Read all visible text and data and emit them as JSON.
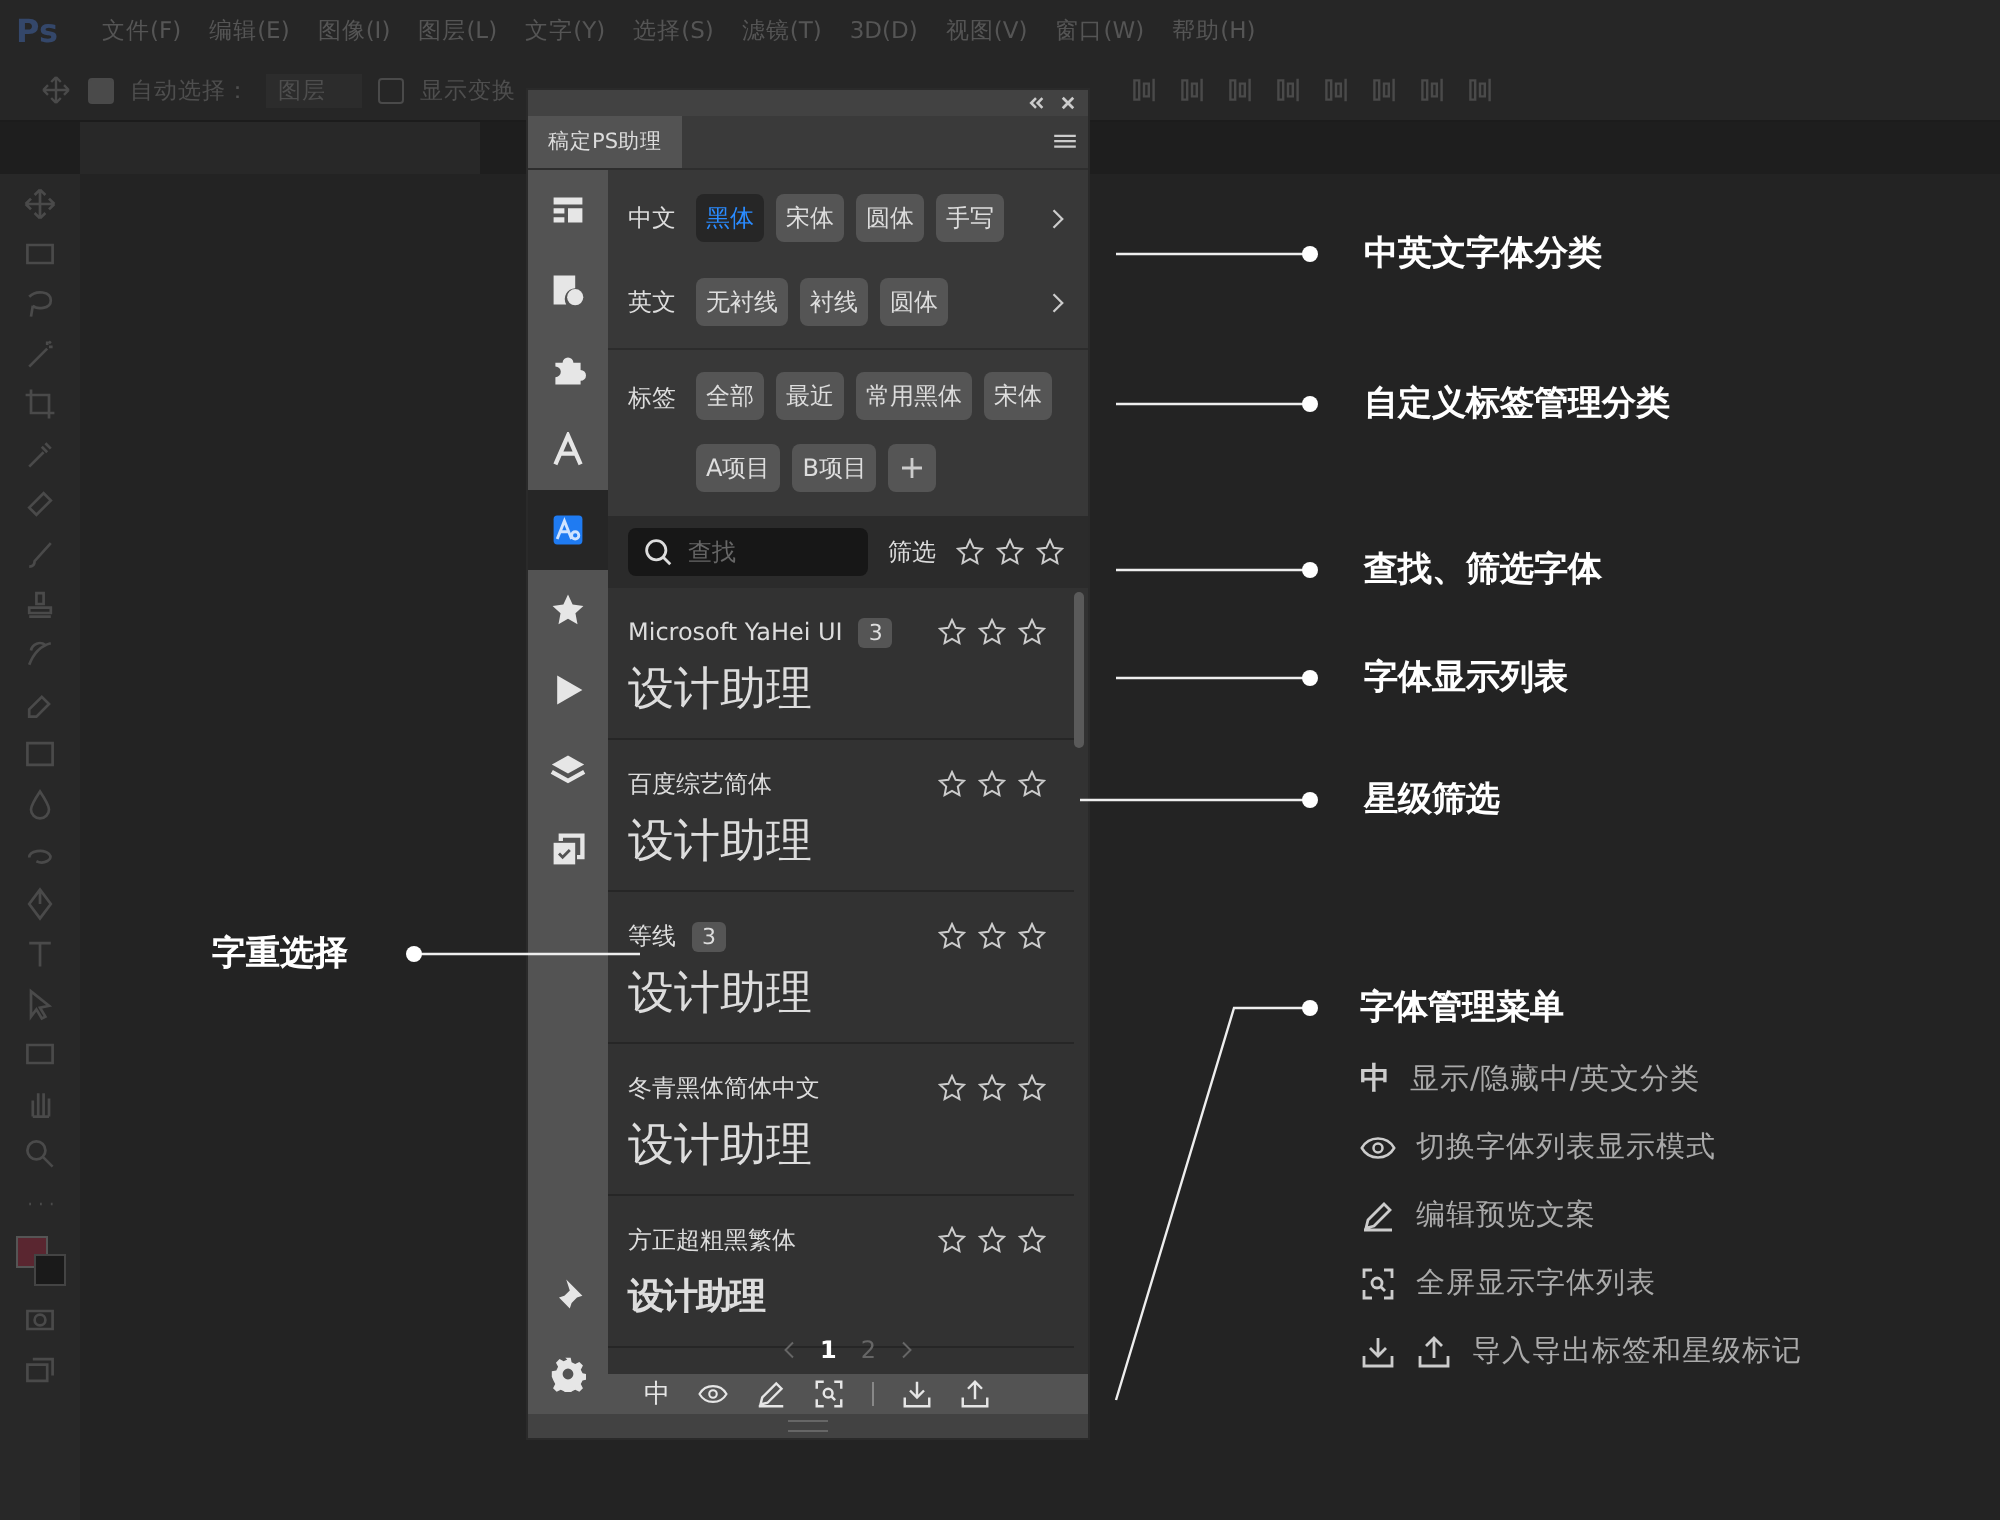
{
  "menu_bar": {
    "logo": "Ps",
    "items": [
      "文件(F)",
      "编辑(E)",
      "图像(I)",
      "图层(L)",
      "文字(Y)",
      "选择(S)",
      "滤镜(T)",
      "3D(D)",
      "视图(V)",
      "窗口(W)",
      "帮助(H)"
    ]
  },
  "options_bar": {
    "auto_select": {
      "label": "自动选择：",
      "checked": true
    },
    "target": "图层",
    "show_transform": {
      "label": "显示变换",
      "checked": false
    }
  },
  "panel": {
    "title": "稿定PS助理",
    "nav": [
      {
        "kind": "layout",
        "selected": false
      },
      {
        "kind": "shapes",
        "selected": false
      },
      {
        "kind": "puzzle",
        "selected": false
      },
      {
        "kind": "text",
        "selected": false
      },
      {
        "kind": "font-search",
        "selected": true
      },
      {
        "kind": "star",
        "selected": false
      },
      {
        "kind": "play",
        "selected": false
      },
      {
        "kind": "layers",
        "selected": false
      },
      {
        "kind": "checklist",
        "selected": false
      }
    ],
    "chinese": {
      "label": "中文",
      "chips": [
        {
          "label": "黑体",
          "selected": true
        },
        {
          "label": "宋体",
          "selected": false
        },
        {
          "label": "圆体",
          "selected": false
        },
        {
          "label": "手写",
          "selected": false
        }
      ]
    },
    "english": {
      "label": "英文",
      "chips": [
        {
          "label": "无衬线",
          "selected": false
        },
        {
          "label": "衬线",
          "selected": false
        },
        {
          "label": "圆体",
          "selected": false
        }
      ]
    },
    "tags": {
      "label": "标签",
      "chips": [
        {
          "label": "全部",
          "selected": false
        },
        {
          "label": "最近",
          "selected": false
        },
        {
          "label": "常用黑体",
          "selected": false
        },
        {
          "label": "宋体",
          "selected": false
        },
        {
          "label": "A项目",
          "selected": false
        },
        {
          "label": "B项目",
          "selected": false
        }
      ]
    },
    "search": {
      "placeholder": "查找"
    },
    "filter": {
      "label": "筛选",
      "stars": 0
    },
    "fonts": [
      {
        "name": "Microsoft YaHei UI",
        "count": "3",
        "preview": "设计助理",
        "kind": "normal",
        "stars": 0
      },
      {
        "name": "百度综艺简体",
        "preview": "设计助理",
        "kind": "normal",
        "stars": 0
      },
      {
        "name": "等线",
        "count": "3",
        "preview": "设计助理",
        "kind": "normal",
        "stars": 0
      },
      {
        "name": "冬青黑体简体中文",
        "preview": "设计助理",
        "kind": "normal",
        "stars": 0
      },
      {
        "name": "方正超粗黑繁体",
        "preview": "设计助理",
        "kind": "heavy",
        "stars": 0
      }
    ],
    "pages": [
      {
        "label": "1",
        "selected": true
      },
      {
        "label": "2",
        "selected": false
      }
    ],
    "toolbar": {
      "lang_toggle": "中"
    }
  },
  "annotations": [
    {
      "title": "中英文字体分类"
    },
    {
      "title": "自定义标签管理分类"
    },
    {
      "title": "查找、筛选字体"
    },
    {
      "title": "字体显示列表"
    },
    {
      "title": "星级筛选"
    }
  ],
  "weight_note": {
    "title": "字重选择"
  },
  "menu_note": {
    "title": "字体管理菜单",
    "items": [
      {
        "kind": "lang",
        "icon_text": "中",
        "text": "显示/隐藏中/英文分类"
      },
      {
        "kind": "eye",
        "text": "切换字体列表显示模式"
      },
      {
        "kind": "edit",
        "text": "编辑预览文案"
      },
      {
        "kind": "scan",
        "text": "全屏显示字体列表"
      },
      {
        "kind": "transfer",
        "text": "导入导出标签和星级标记"
      }
    ]
  }
}
